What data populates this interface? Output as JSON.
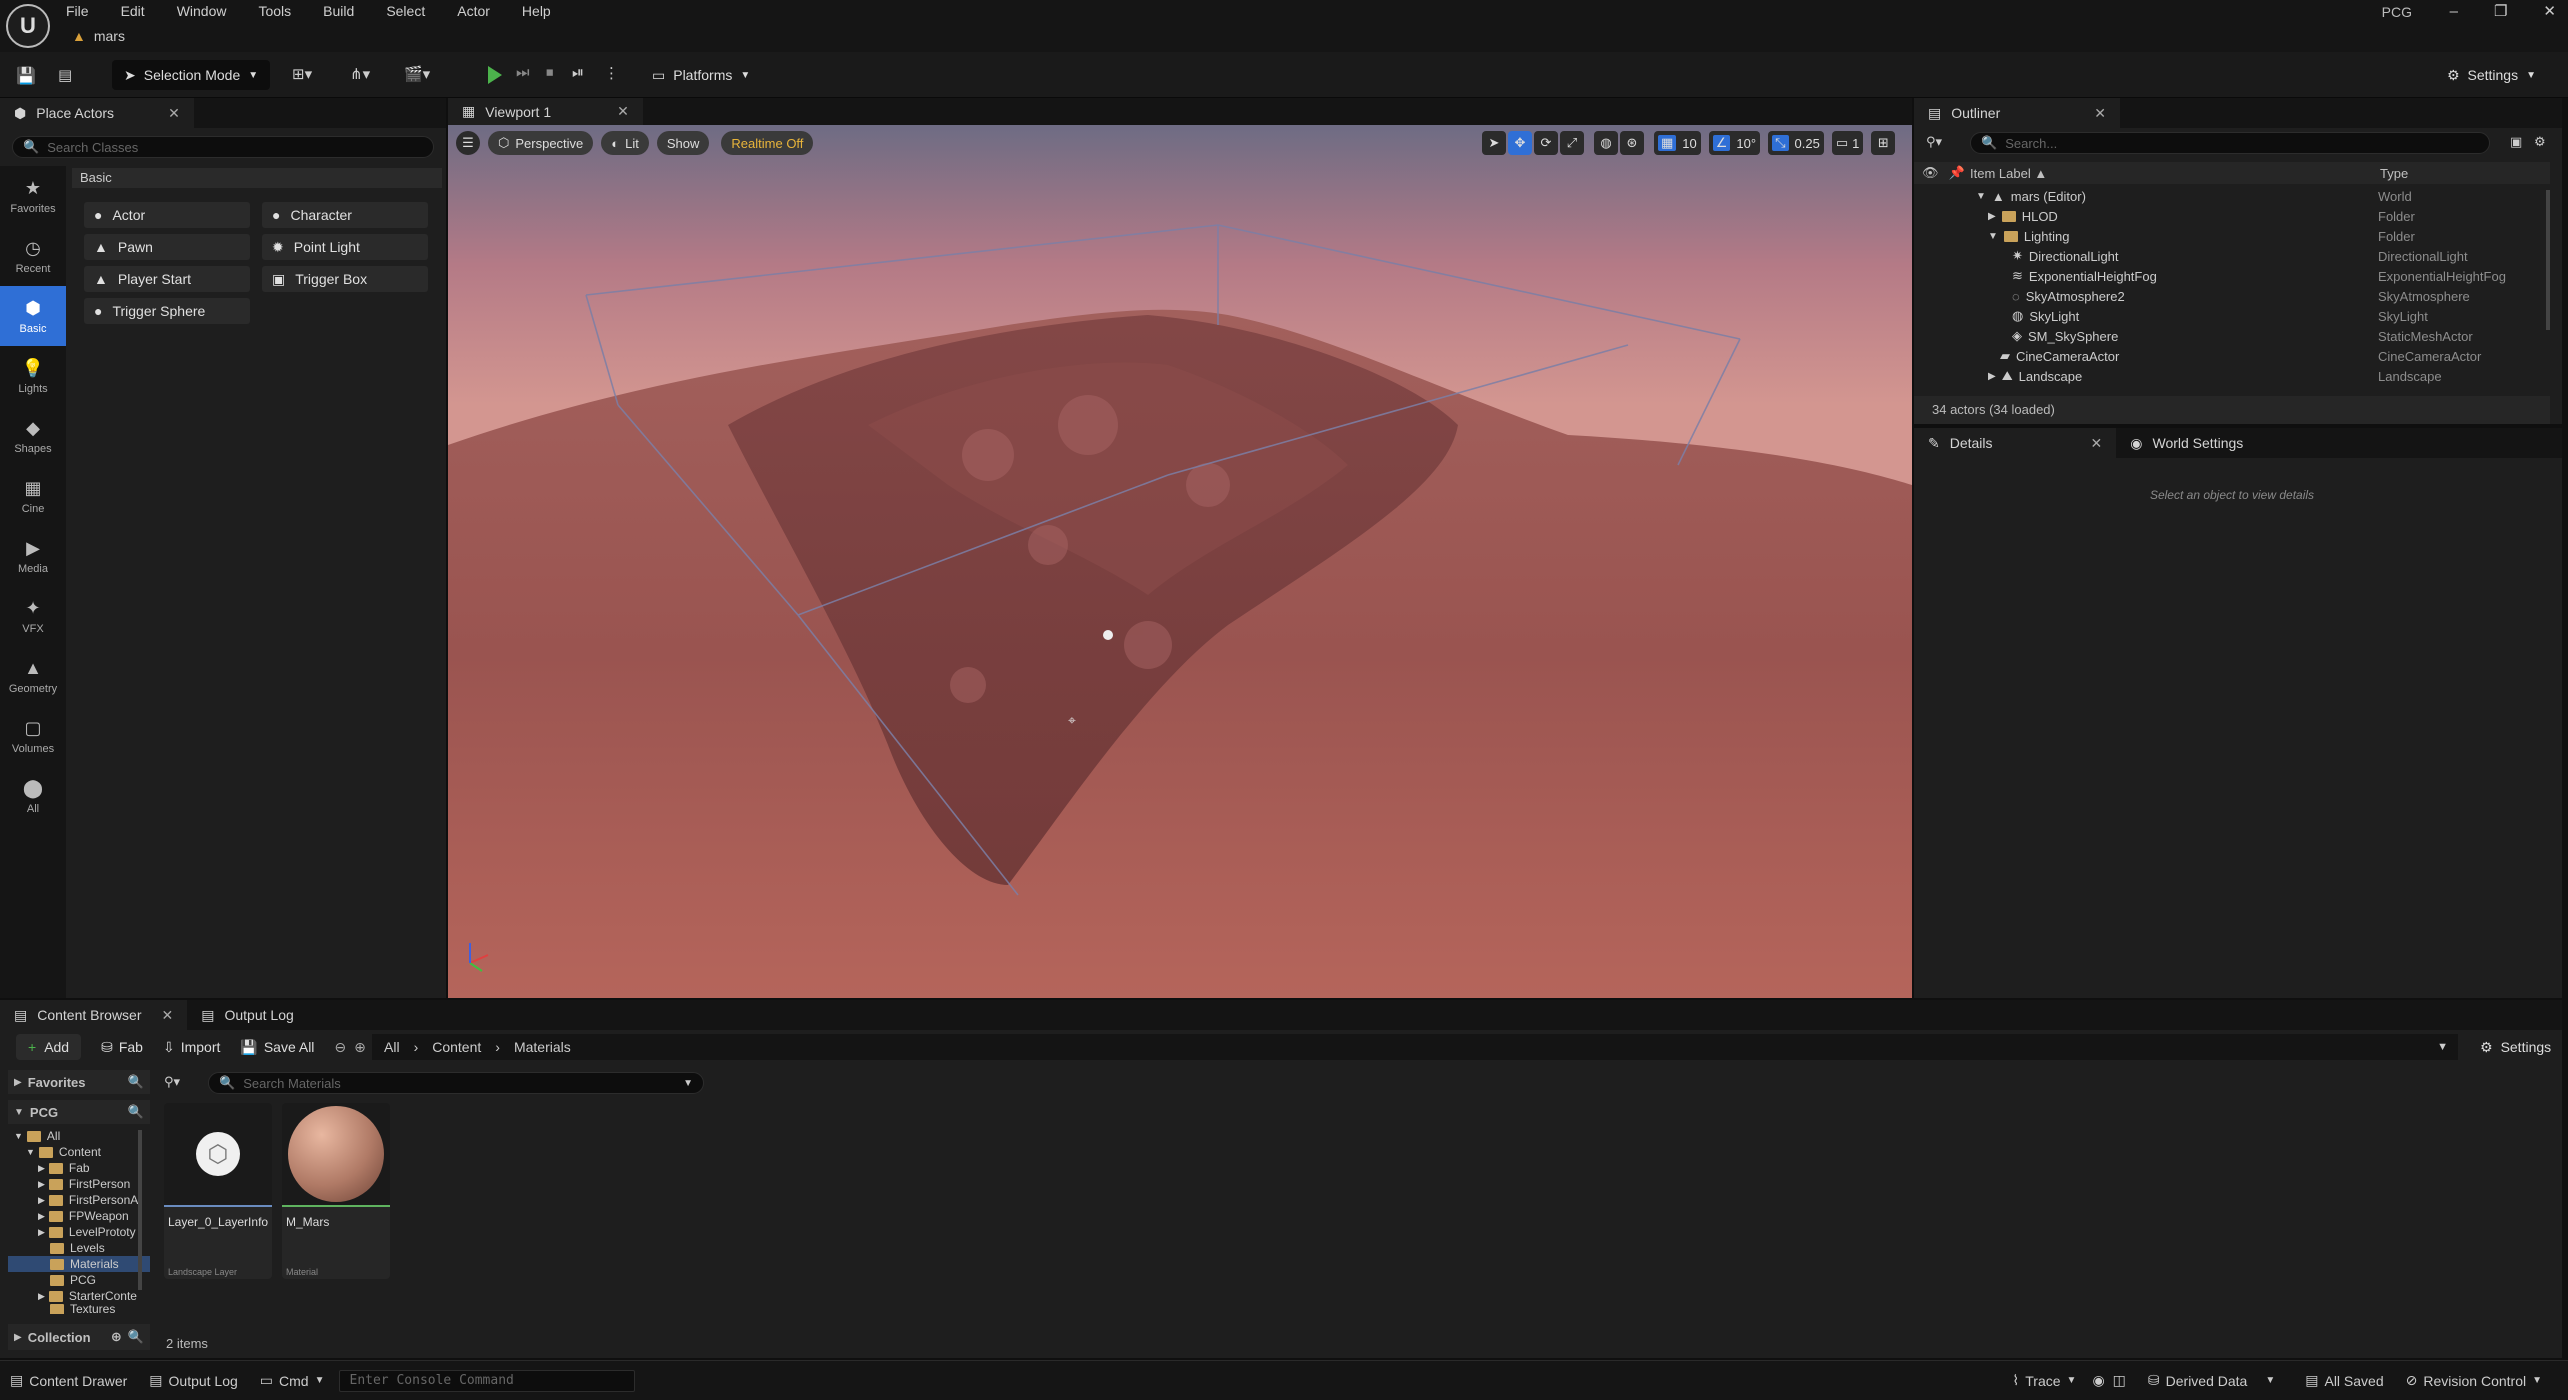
{
  "app": {
    "logo": "U",
    "project_tab": "mars",
    "project_name": "PCG"
  },
  "menu": [
    "File",
    "Edit",
    "Window",
    "Tools",
    "Build",
    "Select",
    "Actor",
    "Help"
  ],
  "window_controls": [
    "–",
    "❐",
    "✕"
  ],
  "toolbar": {
    "selection_mode": "Selection Mode",
    "platforms": "Platforms",
    "settings": "Settings"
  },
  "place_actors": {
    "tab": "Place Actors",
    "search_placeholder": "Search Classes",
    "section": "Basic",
    "sidebar": [
      {
        "label": "Favorites",
        "icon": "★"
      },
      {
        "label": "Recent",
        "icon": "◷"
      },
      {
        "label": "Basic",
        "icon": "⬢"
      },
      {
        "label": "Lights",
        "icon": "💡"
      },
      {
        "label": "Shapes",
        "icon": "◆"
      },
      {
        "label": "Cine",
        "icon": "▦"
      },
      {
        "label": "Media",
        "icon": "▶"
      },
      {
        "label": "VFX",
        "icon": "✦"
      },
      {
        "label": "Geometry",
        "icon": "▲"
      },
      {
        "label": "Volumes",
        "icon": "▢"
      },
      {
        "label": "All",
        "icon": "⬤"
      }
    ],
    "items": [
      {
        "label": "Actor",
        "icon": "●"
      },
      {
        "label": "Character",
        "icon": "●"
      },
      {
        "label": "Pawn",
        "icon": "▲"
      },
      {
        "label": "Point Light",
        "icon": "✹"
      },
      {
        "label": "Player Start",
        "icon": "▲"
      },
      {
        "label": "Trigger Box",
        "icon": "▣"
      },
      {
        "label": "Trigger Sphere",
        "icon": "●"
      }
    ]
  },
  "viewport": {
    "tab": "Viewport 1",
    "perspective": "Perspective",
    "lit": "Lit",
    "show": "Show",
    "realtime": "Realtime Off",
    "grid_snap": "10",
    "rotation_snap": "10°",
    "scale_snap": "0.25",
    "camera_speed": "1"
  },
  "outliner": {
    "tab": "Outliner",
    "search_placeholder": "Search...",
    "col_label": "Item Label ▲",
    "col_type": "Type",
    "rows": [
      {
        "label": "mars (Editor)",
        "type": "World"
      },
      {
        "label": "HLOD",
        "type": "Folder"
      },
      {
        "label": "Lighting",
        "type": "Folder"
      },
      {
        "label": "DirectionalLight",
        "type": "DirectionalLight"
      },
      {
        "label": "ExponentialHeightFog",
        "type": "ExponentialHeightFog"
      },
      {
        "label": "SkyAtmosphere2",
        "type": "SkyAtmosphere"
      },
      {
        "label": "SkyLight",
        "type": "SkyLight"
      },
      {
        "label": "SM_SkySphere",
        "type": "StaticMeshActor"
      },
      {
        "label": "CineCameraActor",
        "type": "CineCameraActor"
      },
      {
        "label": "Landscape",
        "type": "Landscape"
      }
    ],
    "count": "34 actors (34 loaded)"
  },
  "details": {
    "tab": "Details",
    "tab2": "World Settings",
    "empty": "Select an object to view details"
  },
  "content_browser": {
    "tab": "Content Browser",
    "tab2": "Output Log",
    "add": "Add",
    "fab": "Fab",
    "import": "Import",
    "save_all": "Save All",
    "settings": "Settings",
    "breadcrumb": [
      "All",
      "Content",
      "Materials"
    ],
    "favorites": "Favorites",
    "pcg": "PCG",
    "search_placeholder": "Search Materials",
    "tree": [
      "All",
      "Content",
      "Fab",
      "FirstPerson",
      "FirstPersonA",
      "FPWeapon",
      "LevelPrototy",
      "Levels",
      "Materials",
      "PCG",
      "StarterConte",
      "Textures"
    ],
    "collection": "Collection",
    "assets": [
      {
        "name": "Layer_0_LayerInfo",
        "type": "Landscape Layer"
      },
      {
        "name": "M_Mars",
        "type": "Material"
      }
    ],
    "count": "2 items"
  },
  "statusbar": {
    "content_drawer": "Content Drawer",
    "output_log": "Output Log",
    "cmd": "Cmd",
    "console_placeholder": "Enter Console Command",
    "trace": "Trace",
    "derived_data": "Derived Data",
    "all_saved": "All Saved",
    "revision_control": "Revision Control"
  }
}
